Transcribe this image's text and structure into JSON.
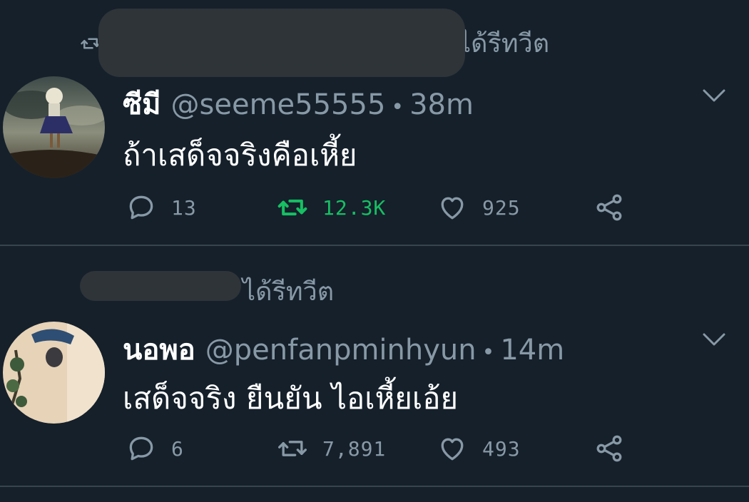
{
  "colors": {
    "background": "#15202b",
    "secondary_text": "#8899a6",
    "divider": "#38444d",
    "retweet_active": "#17bf63",
    "redaction": "#2f3438"
  },
  "tweets": [
    {
      "retweet_context": "ได้รีทวีต",
      "display_name": "ซีมี",
      "handle": "@seeme55555",
      "timestamp": "38m",
      "text": "ถ้าเสด็จจริงคือเหี้ย",
      "reply_count": "13",
      "retweet_count": "12.3K",
      "like_count": "925",
      "retweeted": true,
      "icons": [
        "retweet-icon",
        "avatar",
        "chevron-down-icon",
        "reply-icon",
        "retweet-icon",
        "heart-icon",
        "share-icon"
      ]
    },
    {
      "retweet_context": "ได้รีทวีต",
      "display_name": "นอพอ",
      "handle": "@penfanpminhyun",
      "timestamp": "14m",
      "text": "เสด็จจริง ยืนยัน ไอเหี้ยเอ้ย",
      "reply_count": "6",
      "retweet_count": "7,891",
      "like_count": "493",
      "retweeted": false,
      "icons": [
        "avatar",
        "chevron-down-icon",
        "reply-icon",
        "retweet-icon",
        "heart-icon",
        "share-icon"
      ]
    }
  ]
}
